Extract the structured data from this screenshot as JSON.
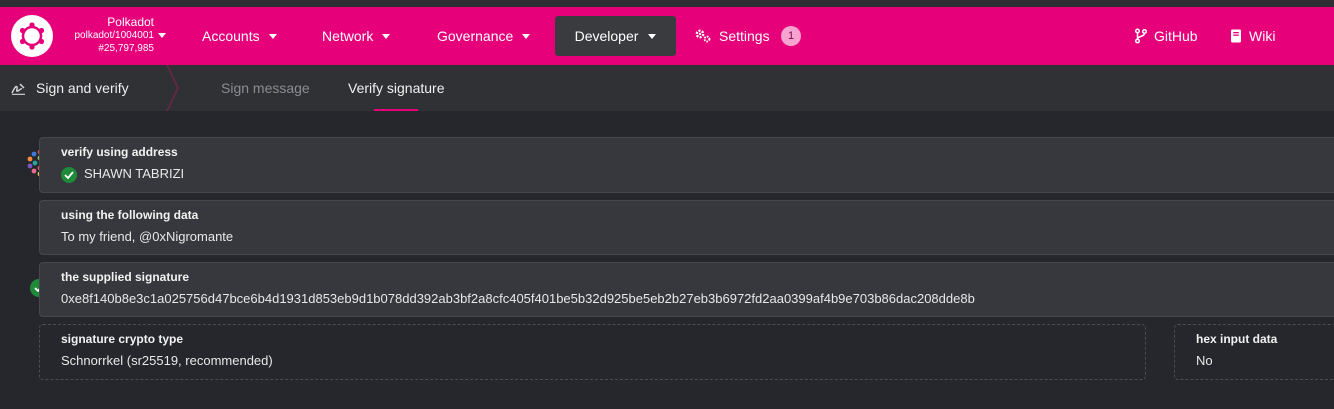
{
  "chain": {
    "name": "Polkadot",
    "version": "polkadot/1004001",
    "block": "#25,797,985"
  },
  "nav": {
    "accounts": "Accounts",
    "network": "Network",
    "governance": "Governance",
    "developer": "Developer",
    "settings": "Settings",
    "settings_badge": "1",
    "github": "GitHub",
    "wiki": "Wiki"
  },
  "subnav": {
    "title": "Sign and verify",
    "tabs": [
      "Sign message",
      "Verify signature"
    ],
    "active_tab": "Verify signature"
  },
  "form": {
    "address": {
      "label": "verify using address",
      "value": "SHAWN TABRIZI"
    },
    "data": {
      "label": "using the following data",
      "value": "To my friend, @0xNigromante"
    },
    "signature": {
      "label": "the supplied signature",
      "value": "0xe8f140b8e3c1a025756d47bce6b4d1931d853eb9d1b078dd392ab3bf2a8cfc405f401be5b32d925be5eb2b27eb3b6972fd2aa0399af4b9e703b86dac208dde8b"
    },
    "crypto_type": {
      "label": "signature crypto type",
      "value": "Schnorrkel (sr25519, recommended)"
    },
    "hex_input": {
      "label": "hex input data",
      "value": "No"
    }
  },
  "colors": {
    "brand": "#e6007a",
    "success": "#1f8a3a"
  },
  "icons": [
    "polkadot-logo-icon",
    "chevron-down-icon",
    "gears-icon",
    "git-branch-icon",
    "book-icon",
    "signature-icon",
    "identicon-icon",
    "check-icon"
  ]
}
